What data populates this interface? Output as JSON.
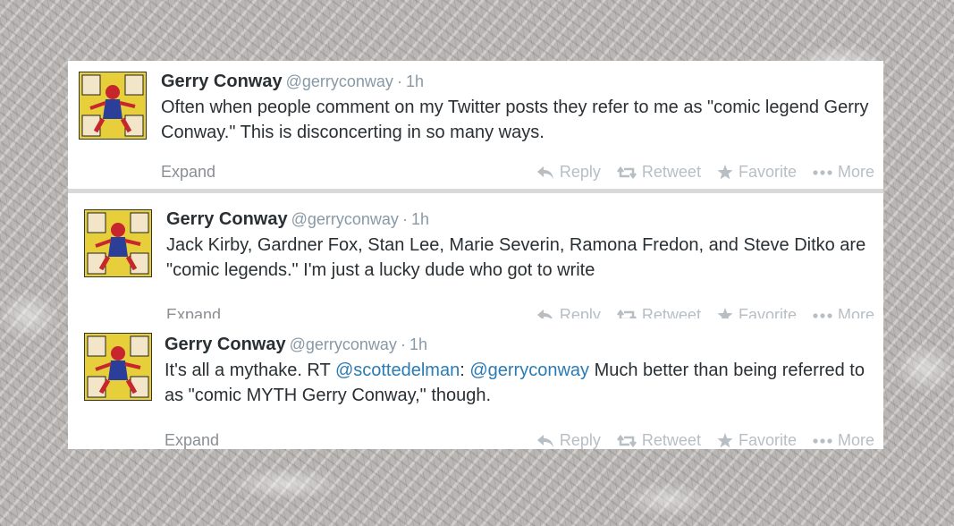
{
  "tweets": [
    {
      "name": "Gerry Conway",
      "handle": "@gerryconway",
      "separator": "·",
      "time": "1h",
      "text": "Often when people comment on my Twitter posts they refer to me as \"comic legend Gerry Conway.\" This is disconcerting in so many ways.",
      "expand": "Expand",
      "actions": {
        "reply": "Reply",
        "retweet": "Retweet",
        "favorite": "Favorite",
        "more": "More"
      }
    },
    {
      "name": "Gerry Conway",
      "handle": "@gerryconway",
      "separator": "·",
      "time": "1h",
      "text": "Jack Kirby, Gardner Fox, Stan Lee, Marie Severin, Ramona Fredon, and Steve Ditko are \"comic legends.\" I'm just a lucky dude who got to write",
      "expand": "Expand",
      "actions": {
        "reply": "Reply",
        "retweet": "Retweet",
        "favorite": "Favorite",
        "more": "More"
      }
    },
    {
      "name": "Gerry Conway",
      "handle": "@gerryconway",
      "separator": "·",
      "time": "1h",
      "text_prefix": "It's all a mythake. RT ",
      "mention1": "@scottedelman",
      "text_colon": ": ",
      "mention2": "@gerryconway",
      "text_suffix": " Much better than being referred to as \"comic MYTH Gerry Conway,\" though.",
      "expand": "Expand",
      "actions": {
        "reply": "Reply",
        "retweet": "Retweet",
        "favorite": "Favorite",
        "more": "More"
      }
    }
  ],
  "colors": {
    "name": "#292f33",
    "meta": "#8899a6",
    "mention": "#2a7bb4",
    "action": "#b7bec4",
    "card": "#ffffff"
  },
  "icons": [
    "reply-icon",
    "retweet-icon",
    "favorite-star-icon",
    "more-dots-icon"
  ]
}
